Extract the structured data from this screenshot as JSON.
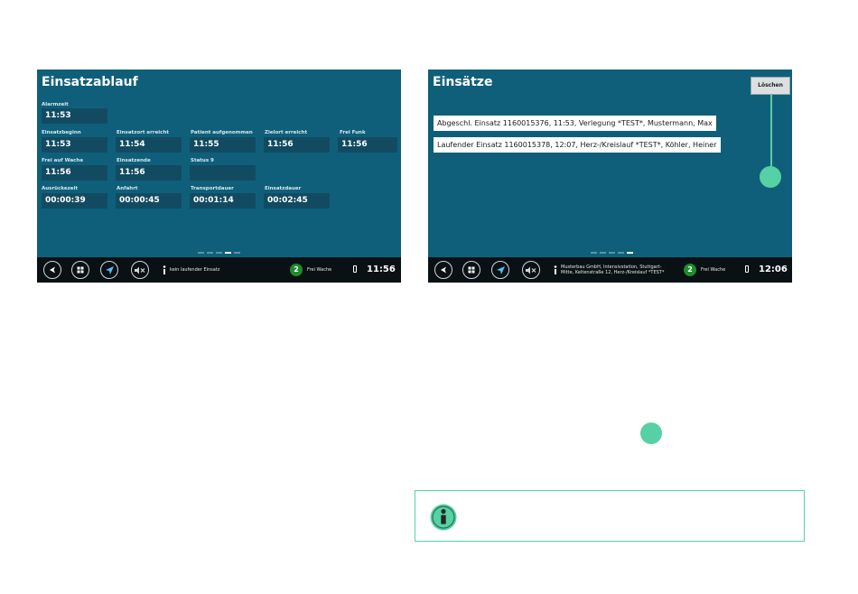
{
  "screen1": {
    "title": "Einsatzablauf",
    "fields": {
      "alarmzeit": {
        "label": "Alarmzeit",
        "value": "11:53"
      },
      "einsatzbeginn": {
        "label": "Einsatzbeginn",
        "value": "11:53"
      },
      "einsatzort_erreicht": {
        "label": "Einsatzort erreicht",
        "value": "11:54"
      },
      "patient_aufgenommen": {
        "label": "Patient aufgenommen",
        "value": "11:55"
      },
      "zielort_erreicht": {
        "label": "Zielort erreicht",
        "value": "11:56"
      },
      "frei_funk": {
        "label": "Frei Funk",
        "value": "11:56"
      },
      "frei_auf_wache": {
        "label": "Frei auf Wache",
        "value": "11:56"
      },
      "einsatzende": {
        "label": "Einsatzende",
        "value": "11:56"
      },
      "status9": {
        "label": "Status 9",
        "value": ""
      },
      "ausrueckezeit": {
        "label": "Ausrückezeit",
        "value": "00:00:39"
      },
      "anfahrt": {
        "label": "Anfahrt",
        "value": "00:00:45"
      },
      "transportdauer": {
        "label": "Transportdauer",
        "value": "00:01:14"
      },
      "einsatzdauer": {
        "label": "Einsatzdauer",
        "value": "00:02:45"
      }
    },
    "statusbar": {
      "mission_text": "kein laufender Einsatz",
      "status_number": "2",
      "status_text": "Frei Wache",
      "clock": "11:56"
    }
  },
  "screen2": {
    "title": "Einsätze",
    "delete_label": "Löschen",
    "missions": [
      "Abgeschl. Einsatz 1160015376, 11:53, Verlegung *TEST*, Mustermann, Max",
      "Laufender Einsatz 1160015378, 12:07, Herz-/Kreislauf *TEST*, Köhler, Heiner"
    ],
    "statusbar": {
      "mission_text_line1": "Musterbau GmbH, Intensivstation, Stuttgart-",
      "mission_text_line2": "Mitte, Keltenstraße 12, Herz-/Kreislauf *TEST*",
      "status_number": "2",
      "status_text": "Frei Wache",
      "clock": "12:06"
    }
  },
  "colors": {
    "screen_bg": "#0f5f7a",
    "field_bg": "#124b61",
    "callout_green": "#56d1a5",
    "status_badge": "#1f8b2d"
  },
  "icons": [
    "back-icon",
    "apps-grid-icon",
    "navigation-arrow-icon",
    "mute-icon",
    "info-icon",
    "battery-icon"
  ]
}
